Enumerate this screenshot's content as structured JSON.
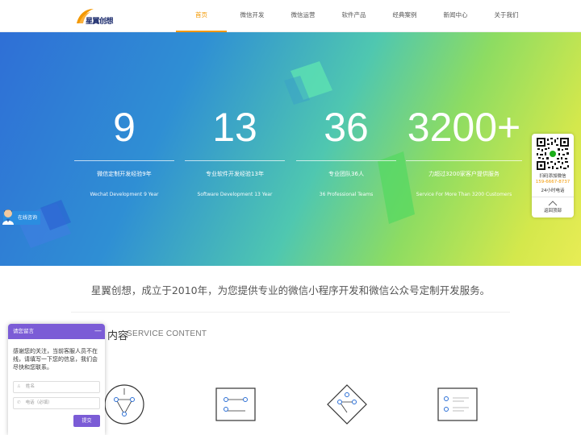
{
  "brand": {
    "logo_text": "星翼创想",
    "accent_color": "#f39800"
  },
  "nav": {
    "items": [
      {
        "label": "首页",
        "active": true
      },
      {
        "label": "微信开发"
      },
      {
        "label": "微信运营"
      },
      {
        "label": "软件产品"
      },
      {
        "label": "经典案例"
      },
      {
        "label": "新闻中心"
      },
      {
        "label": "关于我们"
      }
    ]
  },
  "hero": {
    "stats": [
      {
        "number": "9",
        "label_cn": "微信定制开发经验9年",
        "label_en": "Wechat Development 9 Year"
      },
      {
        "number": "13",
        "label_cn": "专业软件开发经验13年",
        "label_en": "Software Development 13 Year"
      },
      {
        "number": "36",
        "label_cn": "专业团队36人",
        "label_en": "36 Professional Teams"
      },
      {
        "number": "3200+",
        "label_cn": "力超过3200家客户提供服务",
        "label_en": "Service For More Than 3200 Customers"
      }
    ]
  },
  "consult": {
    "label": "在线咨询"
  },
  "qr_panel": {
    "scan_label": "扫码添加微信",
    "phone": "159-6667-8737",
    "hours": "24小时电话",
    "back_top": "返回顶部"
  },
  "intro": {
    "text": "星翼创想，成立于2010年，为您提供专业的微信小程序开发和微信公众号定制开发服务。"
  },
  "service": {
    "title": "内容",
    "subtitle": "SERVICE CONTENT"
  },
  "message_box": {
    "title": "请您留言",
    "minimize": "—",
    "body": "感谢您的关注，当前客服人员不在线，请填写一下您的信息，我们会尽快和您联系。",
    "name_placeholder": "姓名",
    "phone_placeholder": "电话（必填）",
    "submit": "提交"
  }
}
